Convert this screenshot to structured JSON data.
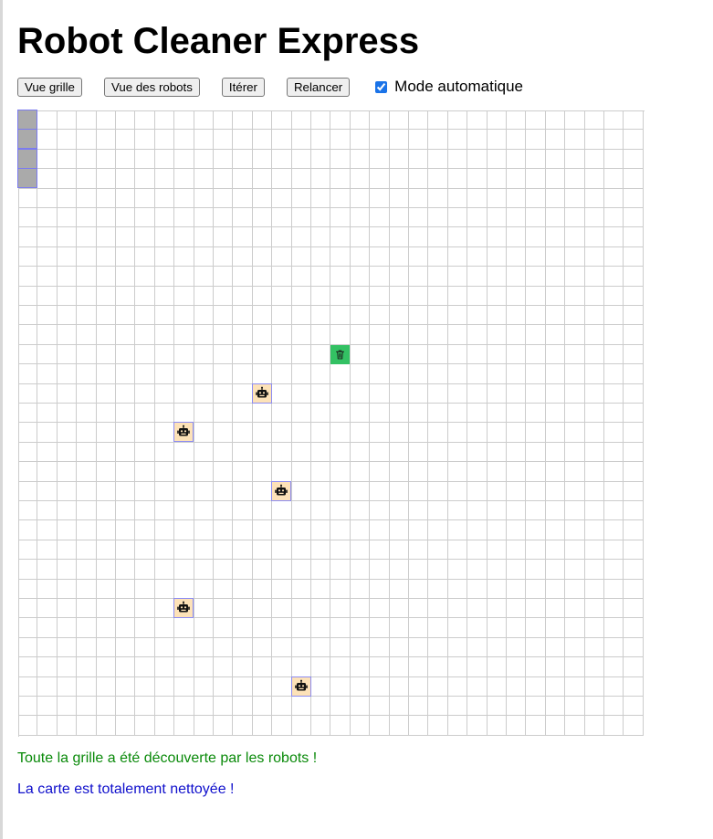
{
  "title": "Robot Cleaner Express",
  "toolbar": {
    "grid_view_label": "Vue grille",
    "robots_view_label": "Vue des robots",
    "iterate_label": "Itérer",
    "restart_label": "Relancer",
    "auto_mode_label": "Mode automatique",
    "auto_mode_checked": true
  },
  "grid": {
    "columns": 32,
    "rows": 32,
    "marked_cells": [
      [
        0,
        0
      ],
      [
        0,
        1
      ],
      [
        0,
        2
      ],
      [
        0,
        3
      ]
    ],
    "trash_cells": [
      [
        16,
        12
      ]
    ],
    "robots": [
      [
        12,
        14
      ],
      [
        8,
        16
      ],
      [
        13,
        19
      ],
      [
        8,
        25
      ],
      [
        14,
        29
      ]
    ],
    "robot_icon": "robot-icon",
    "trash_icon": "trash-icon",
    "colors": {
      "grid_line": "#cccccc",
      "marked": "#aaaaaa",
      "robot_bg": "#fde2b8",
      "robot_border": "#8c8cf2",
      "trash_bg": "#33c163"
    }
  },
  "messages": {
    "discovered": "Toute la grille a été découverte par les robots !",
    "cleaned": "La carte est totalement nettoyée !"
  }
}
